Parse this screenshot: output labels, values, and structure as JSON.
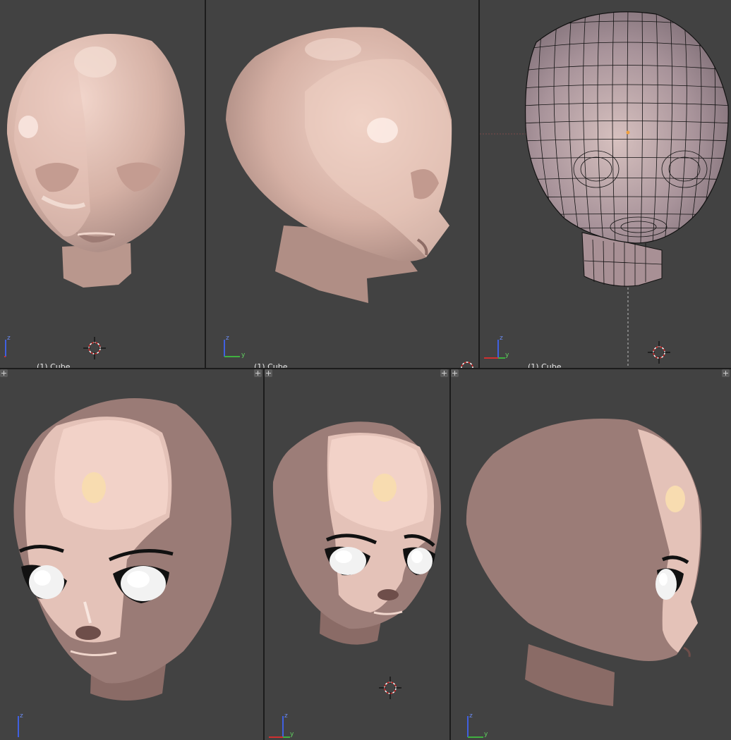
{
  "viewports": [
    {
      "id": "top-left",
      "object_label": "(1) Cube",
      "shading": "solid"
    },
    {
      "id": "top-middle",
      "object_label": "(1) Cube",
      "shading": "solid"
    },
    {
      "id": "top-right",
      "object_label": "(1) Cube",
      "shading": "wireframe"
    },
    {
      "id": "bottom-left",
      "object_label": "",
      "shading": "rendered"
    },
    {
      "id": "bottom-middle",
      "object_label": "",
      "shading": "rendered"
    },
    {
      "id": "bottom-right",
      "object_label": "",
      "shading": "rendered"
    }
  ],
  "axis_labels": {
    "z": "z",
    "y": "y"
  },
  "colors": {
    "viewport_bg": "#424242",
    "skin_light": "#e9c9bd",
    "skin_mid": "#c8a397",
    "skin_dark": "#8d6d66",
    "wire": "#111111",
    "axis_x": "#d03030",
    "axis_y": "#40b040",
    "axis_z": "#4060e0"
  }
}
